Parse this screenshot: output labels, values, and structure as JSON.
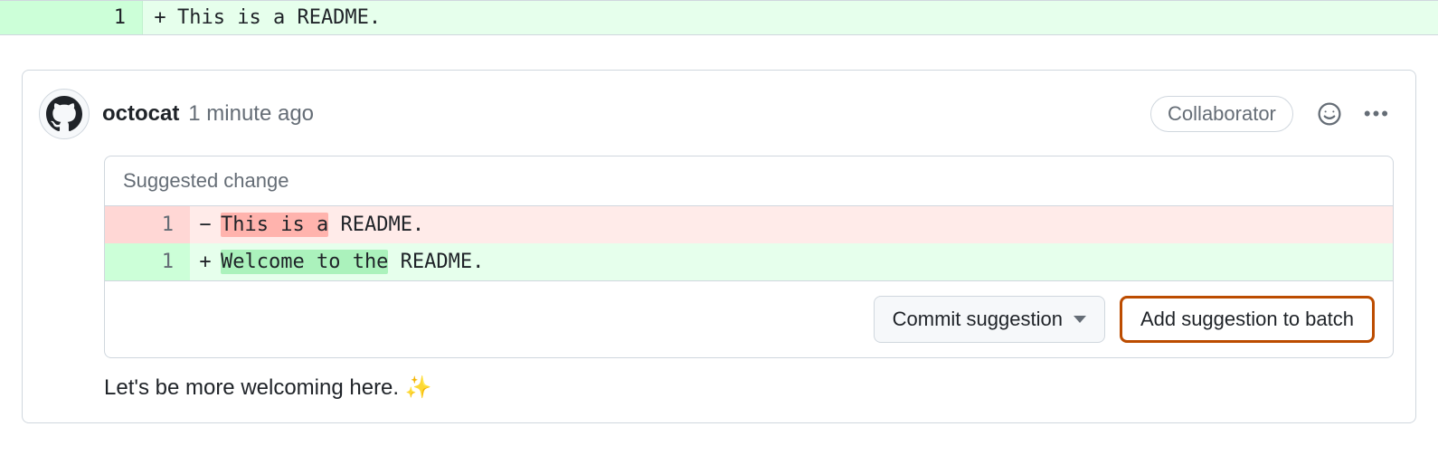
{
  "top_diff": {
    "line_number": "1",
    "marker": "+",
    "text": "This is a README."
  },
  "comment": {
    "author": "octocat",
    "timestamp": "1 minute ago",
    "role_badge": "Collaborator",
    "body_text": "Let's be more welcoming here. ",
    "body_emoji": "✨"
  },
  "suggestion": {
    "header": "Suggested change",
    "removed": {
      "line_number": "1",
      "marker": "−",
      "highlight": "This is a",
      "rest": " README."
    },
    "added": {
      "line_number": "1",
      "marker": "+",
      "highlight": "Welcome to the",
      "rest": " README."
    },
    "commit_button": "Commit suggestion",
    "batch_button": "Add suggestion to batch"
  }
}
